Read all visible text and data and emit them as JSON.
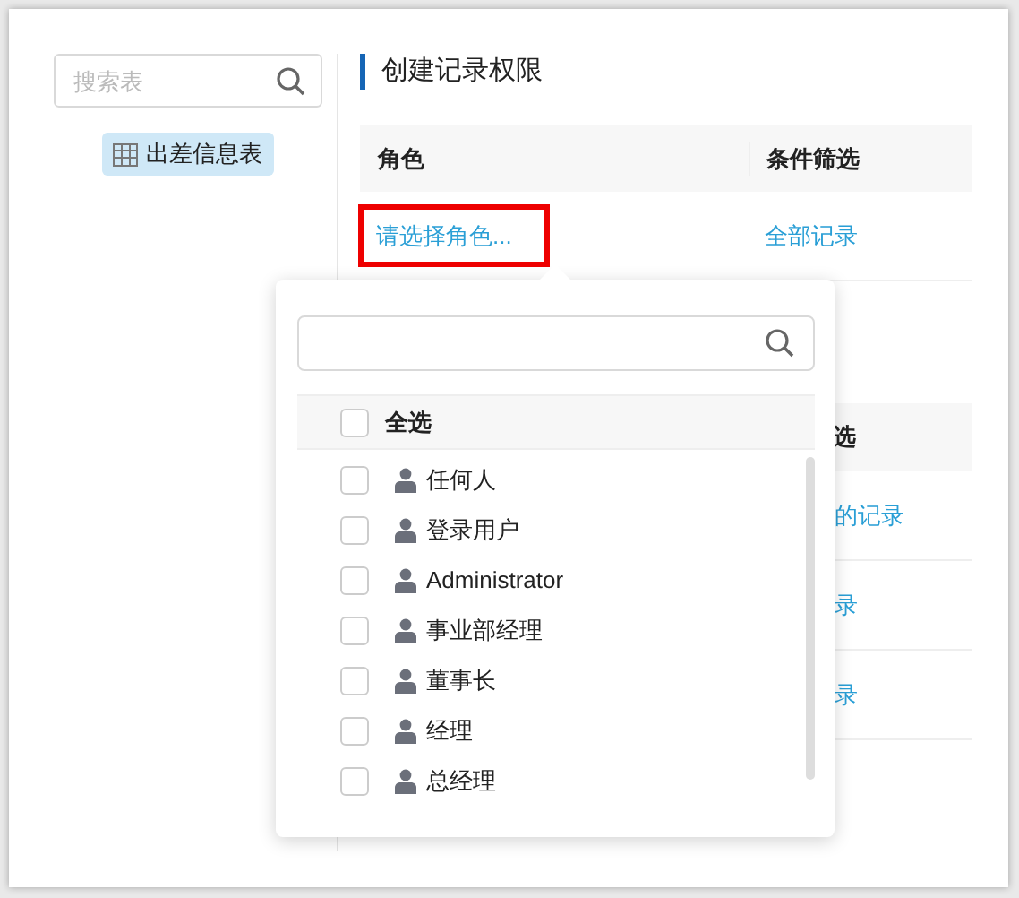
{
  "sidebar": {
    "search": {
      "placeholder": "搜索表"
    },
    "items": [
      {
        "label": "出差信息表",
        "selected": true
      }
    ]
  },
  "section": {
    "title": "创建记录权限",
    "table": {
      "columns": [
        "角色",
        "条件筛选"
      ],
      "rows": [
        {
          "role": "请选择角色...",
          "filter": "全部记录"
        }
      ]
    }
  },
  "background_table": {
    "header_fragment": "选",
    "row_fragments": [
      "的记录",
      "录",
      "录"
    ]
  },
  "role_picker": {
    "select_all": {
      "label": "全选",
      "checked": false
    },
    "items": [
      {
        "label": "任何人",
        "checked": false
      },
      {
        "label": "登录用户",
        "checked": false
      },
      {
        "label": "Administrator",
        "checked": false
      },
      {
        "label": "事业部经理",
        "checked": false
      },
      {
        "label": "董事长",
        "checked": false
      },
      {
        "label": "经理",
        "checked": false
      },
      {
        "label": "总经理",
        "checked": false
      }
    ]
  }
}
